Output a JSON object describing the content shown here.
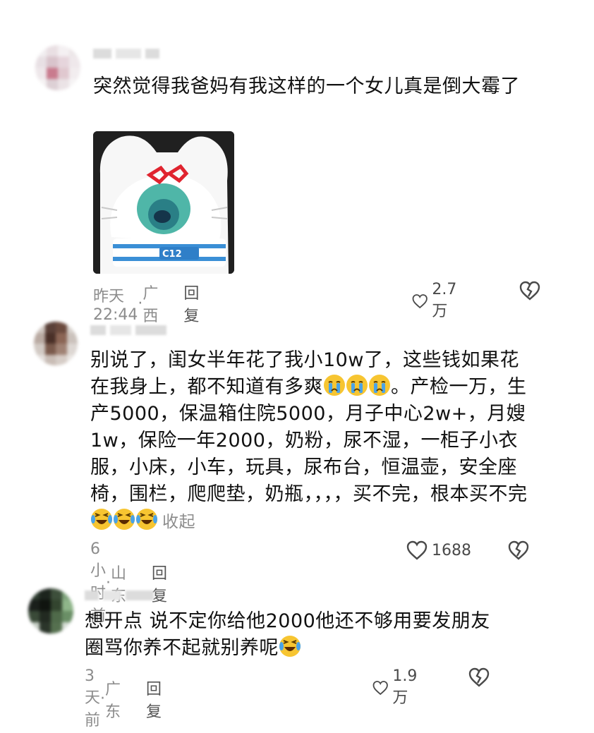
{
  "comments": [
    {
      "text": "突然觉得我爸妈有我这样的一个女儿真是倒大霉了",
      "time": "昨天 22:44",
      "location": "广西",
      "reply": "回复",
      "likes": "2.7万",
      "avatar_icon": "blurred-avatar",
      "sticker_icon": "crying-cat-sticker"
    },
    {
      "text": "别说了，闺女半年花了我小10w了，这些钱如果花在我身上，都不知道有多爽",
      "text_cont": "。产检一万，生产5000，保温箱住院5000，月子中心2w+，月嫂1w，保险一年2000，奶粉，尿不湿，一柜子小衣服，小床，小车，玩具，尿布台，恒温壶，安全座椅，围栏，爬爬垫，奶瓶，，，，买不完，根本买不完",
      "collapse": "收起",
      "time": "6小时前",
      "location": "山东",
      "reply": "回复",
      "likes": "1688",
      "emoji_1": "crying-face-emoji",
      "emoji_2": "laughing-tears-emoji"
    },
    {
      "text": "想开点 说不定你给他2000他还不够用要发朋友圈骂你养不起就别养呢",
      "time": "3天前",
      "location": "广东",
      "reply": "回复",
      "likes": "1.9万",
      "emoji": "laughing-tears-emoji"
    }
  ],
  "separator": "·",
  "colors": {
    "text": "#111111",
    "meta": "#8c8c8c",
    "icon": "#4a4a4a",
    "sticker_glasses": "#e0242f",
    "sticker_stripe": "#3a8fd6"
  }
}
